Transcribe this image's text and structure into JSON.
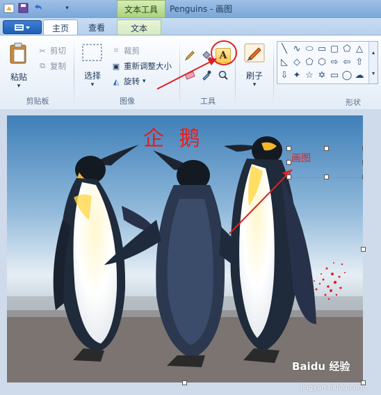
{
  "window": {
    "title": "Penguins - 画图",
    "context_tab_label": "文本工具"
  },
  "qat": {
    "save_icon": "save-icon",
    "undo_icon": "undo-icon",
    "redo_icon": "redo-icon"
  },
  "tabs": [
    {
      "label": "主页",
      "active": true
    },
    {
      "label": "查看",
      "active": false
    },
    {
      "label": "文本",
      "active": false
    }
  ],
  "groups": {
    "clipboard": {
      "label": "剪贴板",
      "paste": "粘贴",
      "cut": "剪切",
      "copy": "复制"
    },
    "image": {
      "label": "图像",
      "select": "选择",
      "crop": "裁剪",
      "resize": "重新调整大小",
      "rotate": "旋转"
    },
    "tools": {
      "label": "工具"
    },
    "brushes": {
      "label": "刷子"
    },
    "shapes": {
      "label": "形状"
    }
  },
  "canvas": {
    "annotation_title": "企 鹅",
    "text_box_content": "画图"
  },
  "watermark": {
    "brand": "Baidu 经验",
    "url": "jingyan.baidu.com"
  },
  "colors": {
    "accent_red": "#e02020",
    "ribbon_bg": "#eef3fa",
    "context_green": "#a9d27a"
  }
}
